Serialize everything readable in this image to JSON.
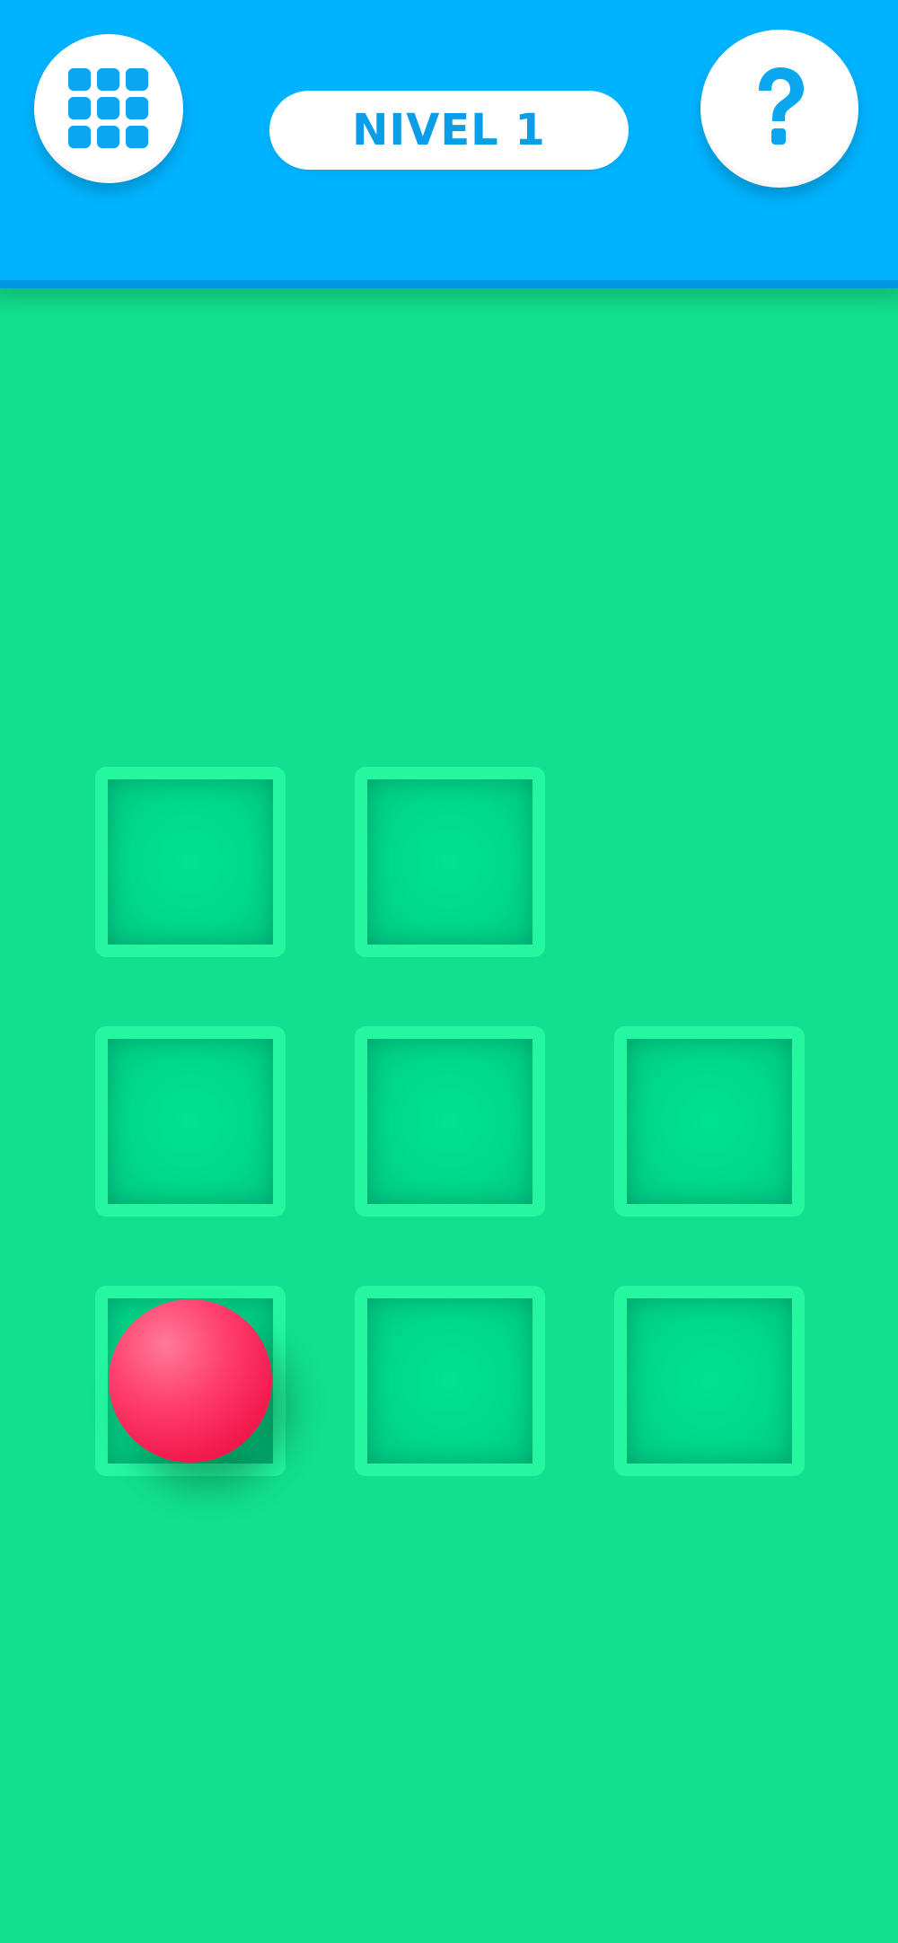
{
  "header": {
    "level_label": "NIVEL 1",
    "menu_icon": "grid-icon",
    "help_icon": "question-mark-icon"
  },
  "colors": {
    "header_bg": "#00b3ff",
    "board_bg": "#12df8f",
    "cell_border": "#24f7a0",
    "ball": "#f41b4f",
    "accent_text": "#0a9ee8"
  },
  "board": {
    "rows": 3,
    "cols": 3,
    "cells": [
      {
        "row": 0,
        "col": 0,
        "present": true
      },
      {
        "row": 0,
        "col": 1,
        "present": true
      },
      {
        "row": 0,
        "col": 2,
        "present": false
      },
      {
        "row": 1,
        "col": 0,
        "present": true
      },
      {
        "row": 1,
        "col": 1,
        "present": true
      },
      {
        "row": 1,
        "col": 2,
        "present": true
      },
      {
        "row": 2,
        "col": 0,
        "present": true
      },
      {
        "row": 2,
        "col": 1,
        "present": true
      },
      {
        "row": 2,
        "col": 2,
        "present": true
      }
    ],
    "ball": {
      "row": 2,
      "col": 0
    }
  }
}
